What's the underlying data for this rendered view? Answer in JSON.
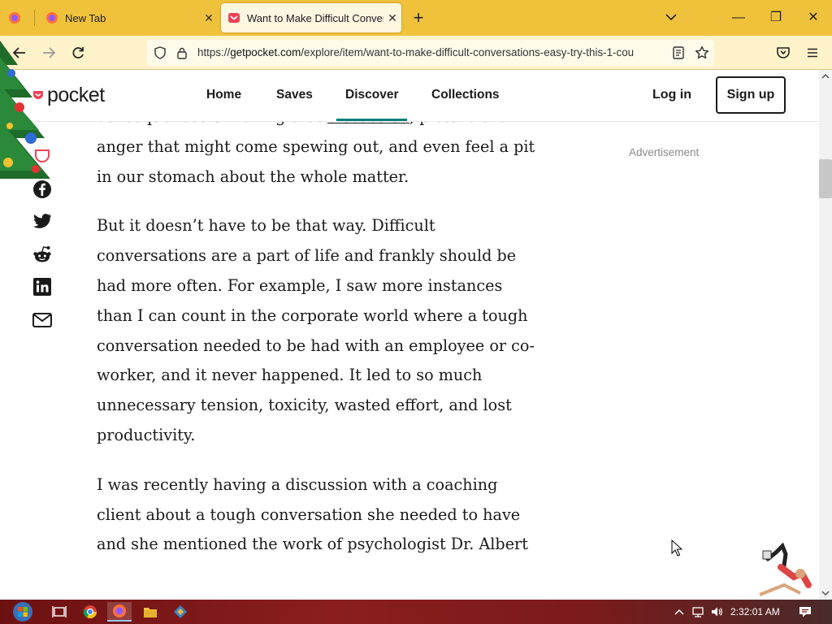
{
  "browser": {
    "tabs": [
      {
        "label": "New Tab"
      },
      {
        "label": "Want to Make Difficult Convers"
      }
    ],
    "url": {
      "prefix": "https://",
      "host": "getpocket.com",
      "path": "/explore/item/want-to-make-difficult-conversations-easy-try-this-1-cou"
    }
  },
  "site": {
    "logo_text": "pocket",
    "nav": [
      {
        "label": "Home"
      },
      {
        "label": "Saves"
      },
      {
        "label": "Discover"
      },
      {
        "label": "Collections"
      }
    ],
    "active_nav": "Discover",
    "login_label": "Log in",
    "signup_label": "Sign up",
    "ad_label": "Advertisement"
  },
  "article": {
    "p1_pre": "consequences of having that ",
    "p1_link": "discussion",
    "p1_post": ", picture the anger that might come spewing out, and even feel a pit in our stomach about the whole matter.",
    "p2": "But it doesn’t have to be that way. Difficult conversations are a part of life and frankly should be had more often. For example, I saw more instances than I can count in the corporate world where a tough conversation needed to be had with an employee or co-worker, and it never happened. It led to so much unnecessary tension, toxicity, wasted effort, and lost productivity.",
    "p3": "I was recently having a discussion with a coaching client about a tough conversation she needed to have and she mentioned the work of psychologist Dr. Albert"
  },
  "share_icons": [
    "pocket-save-icon",
    "facebook-icon",
    "twitter-icon",
    "reddit-icon",
    "linkedin-icon",
    "email-icon"
  ],
  "taskbar": {
    "clock": "2:32:01 AM"
  },
  "colors": {
    "tabbar": "#f0c23b",
    "navbar": "#fdf2c9",
    "accent": "#008078",
    "pocket_red": "#ef4056"
  }
}
